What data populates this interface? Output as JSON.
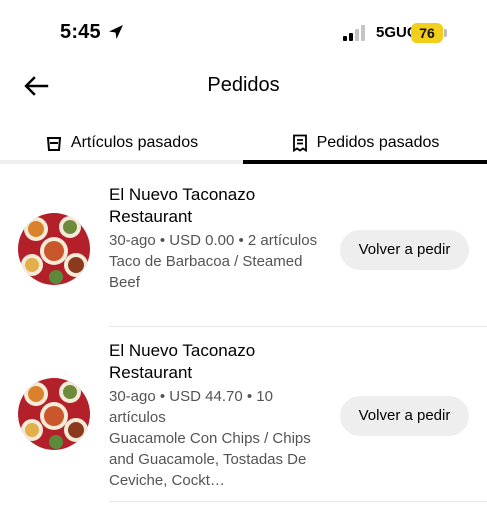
{
  "status_bar": {
    "time": "5:45",
    "network": "5GUC",
    "battery": "76",
    "battery_color": "#f2cf1c"
  },
  "header": {
    "back_icon": "arrow-left-icon",
    "title": "Pedidos"
  },
  "tabs": [
    {
      "label": "Artículos pasados",
      "icon": "basket-icon",
      "selected": false
    },
    {
      "label": "Pedidos pasados",
      "icon": "receipt-icon",
      "selected": true
    }
  ],
  "orders": [
    {
      "restaurant": "El Nuevo Taconazo Restaurant",
      "meta": "30-ago • USD 0.00 • 2 artículos",
      "items": "Taco de Barbacoa / Steamed Beef",
      "reorder_label": "Volver a pedir"
    },
    {
      "restaurant": "El Nuevo Taconazo Restaurant",
      "meta": "30-ago • USD 44.70 • 10 artículos",
      "items": "Guacamole Con Chips / Chips and Guacamole, Tostadas De Ceviche, Cockt…",
      "reorder_label": "Volver a pedir"
    }
  ],
  "colors": {
    "accent": "#000000",
    "button_bg": "#eeeeee",
    "secondary_text": "#545454"
  }
}
